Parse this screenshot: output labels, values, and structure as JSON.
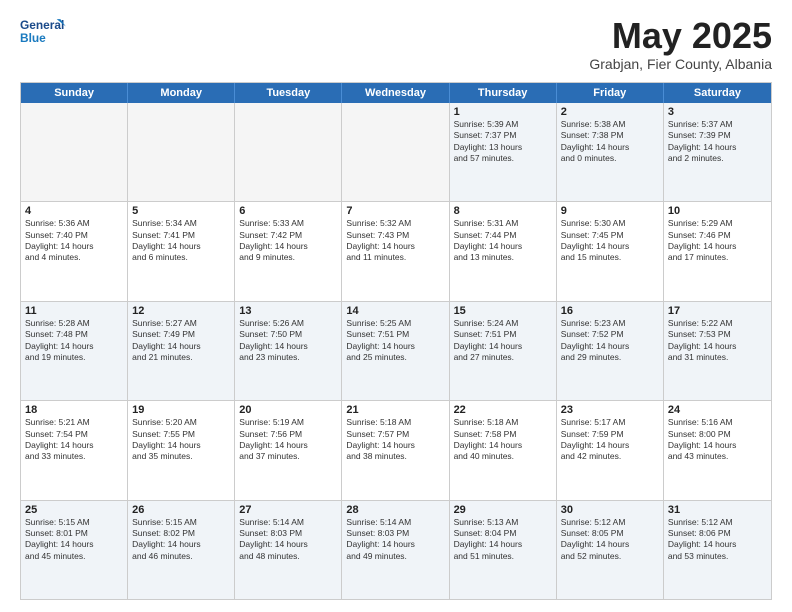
{
  "header": {
    "logo_line1": "General",
    "logo_line2": "Blue",
    "month": "May 2025",
    "location": "Grabjan, Fier County, Albania"
  },
  "days": [
    "Sunday",
    "Monday",
    "Tuesday",
    "Wednesday",
    "Thursday",
    "Friday",
    "Saturday"
  ],
  "rows": [
    [
      {
        "day": "",
        "text": ""
      },
      {
        "day": "",
        "text": ""
      },
      {
        "day": "",
        "text": ""
      },
      {
        "day": "",
        "text": ""
      },
      {
        "day": "1",
        "text": "Sunrise: 5:39 AM\nSunset: 7:37 PM\nDaylight: 13 hours\nand 57 minutes."
      },
      {
        "day": "2",
        "text": "Sunrise: 5:38 AM\nSunset: 7:38 PM\nDaylight: 14 hours\nand 0 minutes."
      },
      {
        "day": "3",
        "text": "Sunrise: 5:37 AM\nSunset: 7:39 PM\nDaylight: 14 hours\nand 2 minutes."
      }
    ],
    [
      {
        "day": "4",
        "text": "Sunrise: 5:36 AM\nSunset: 7:40 PM\nDaylight: 14 hours\nand 4 minutes."
      },
      {
        "day": "5",
        "text": "Sunrise: 5:34 AM\nSunset: 7:41 PM\nDaylight: 14 hours\nand 6 minutes."
      },
      {
        "day": "6",
        "text": "Sunrise: 5:33 AM\nSunset: 7:42 PM\nDaylight: 14 hours\nand 9 minutes."
      },
      {
        "day": "7",
        "text": "Sunrise: 5:32 AM\nSunset: 7:43 PM\nDaylight: 14 hours\nand 11 minutes."
      },
      {
        "day": "8",
        "text": "Sunrise: 5:31 AM\nSunset: 7:44 PM\nDaylight: 14 hours\nand 13 minutes."
      },
      {
        "day": "9",
        "text": "Sunrise: 5:30 AM\nSunset: 7:45 PM\nDaylight: 14 hours\nand 15 minutes."
      },
      {
        "day": "10",
        "text": "Sunrise: 5:29 AM\nSunset: 7:46 PM\nDaylight: 14 hours\nand 17 minutes."
      }
    ],
    [
      {
        "day": "11",
        "text": "Sunrise: 5:28 AM\nSunset: 7:48 PM\nDaylight: 14 hours\nand 19 minutes."
      },
      {
        "day": "12",
        "text": "Sunrise: 5:27 AM\nSunset: 7:49 PM\nDaylight: 14 hours\nand 21 minutes."
      },
      {
        "day": "13",
        "text": "Sunrise: 5:26 AM\nSunset: 7:50 PM\nDaylight: 14 hours\nand 23 minutes."
      },
      {
        "day": "14",
        "text": "Sunrise: 5:25 AM\nSunset: 7:51 PM\nDaylight: 14 hours\nand 25 minutes."
      },
      {
        "day": "15",
        "text": "Sunrise: 5:24 AM\nSunset: 7:51 PM\nDaylight: 14 hours\nand 27 minutes."
      },
      {
        "day": "16",
        "text": "Sunrise: 5:23 AM\nSunset: 7:52 PM\nDaylight: 14 hours\nand 29 minutes."
      },
      {
        "day": "17",
        "text": "Sunrise: 5:22 AM\nSunset: 7:53 PM\nDaylight: 14 hours\nand 31 minutes."
      }
    ],
    [
      {
        "day": "18",
        "text": "Sunrise: 5:21 AM\nSunset: 7:54 PM\nDaylight: 14 hours\nand 33 minutes."
      },
      {
        "day": "19",
        "text": "Sunrise: 5:20 AM\nSunset: 7:55 PM\nDaylight: 14 hours\nand 35 minutes."
      },
      {
        "day": "20",
        "text": "Sunrise: 5:19 AM\nSunset: 7:56 PM\nDaylight: 14 hours\nand 37 minutes."
      },
      {
        "day": "21",
        "text": "Sunrise: 5:18 AM\nSunset: 7:57 PM\nDaylight: 14 hours\nand 38 minutes."
      },
      {
        "day": "22",
        "text": "Sunrise: 5:18 AM\nSunset: 7:58 PM\nDaylight: 14 hours\nand 40 minutes."
      },
      {
        "day": "23",
        "text": "Sunrise: 5:17 AM\nSunset: 7:59 PM\nDaylight: 14 hours\nand 42 minutes."
      },
      {
        "day": "24",
        "text": "Sunrise: 5:16 AM\nSunset: 8:00 PM\nDaylight: 14 hours\nand 43 minutes."
      }
    ],
    [
      {
        "day": "25",
        "text": "Sunrise: 5:15 AM\nSunset: 8:01 PM\nDaylight: 14 hours\nand 45 minutes."
      },
      {
        "day": "26",
        "text": "Sunrise: 5:15 AM\nSunset: 8:02 PM\nDaylight: 14 hours\nand 46 minutes."
      },
      {
        "day": "27",
        "text": "Sunrise: 5:14 AM\nSunset: 8:03 PM\nDaylight: 14 hours\nand 48 minutes."
      },
      {
        "day": "28",
        "text": "Sunrise: 5:14 AM\nSunset: 8:03 PM\nDaylight: 14 hours\nand 49 minutes."
      },
      {
        "day": "29",
        "text": "Sunrise: 5:13 AM\nSunset: 8:04 PM\nDaylight: 14 hours\nand 51 minutes."
      },
      {
        "day": "30",
        "text": "Sunrise: 5:12 AM\nSunset: 8:05 PM\nDaylight: 14 hours\nand 52 minutes."
      },
      {
        "day": "31",
        "text": "Sunrise: 5:12 AM\nSunset: 8:06 PM\nDaylight: 14 hours\nand 53 minutes."
      }
    ]
  ],
  "alt_rows": [
    0,
    2,
    4
  ]
}
